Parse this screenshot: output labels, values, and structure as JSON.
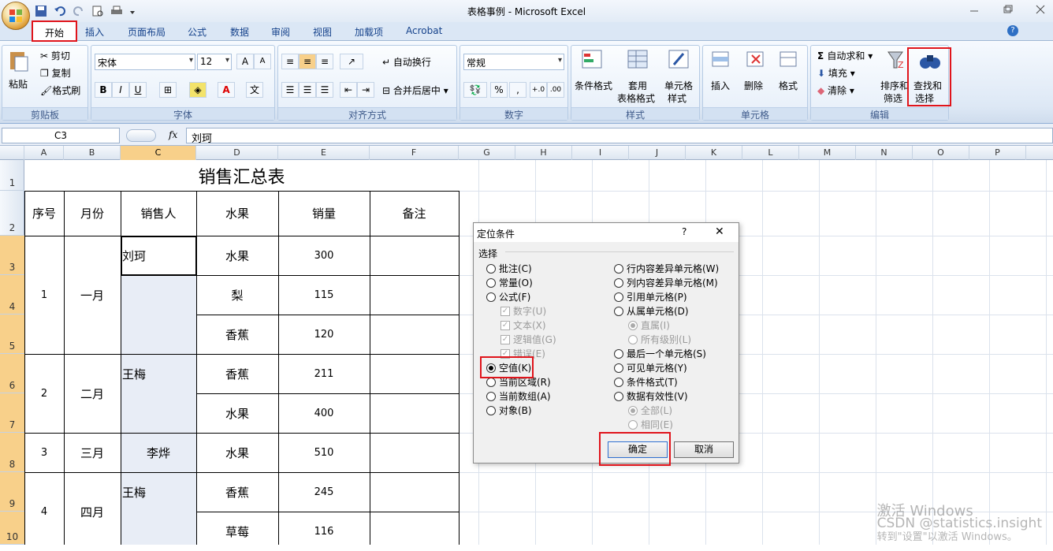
{
  "window": {
    "title": "表格事例 - Microsoft Excel"
  },
  "tabs": [
    "开始",
    "插入",
    "页面布局",
    "公式",
    "数据",
    "审阅",
    "视图",
    "加载项",
    "Acrobat"
  ],
  "ribbon": {
    "clipboard": {
      "paste": "粘贴",
      "cut": "剪切",
      "copy": "复制",
      "format_painter": "格式刷",
      "label": "剪贴板"
    },
    "font": {
      "name": "宋体",
      "size": "12",
      "label": "字体",
      "bold": "B",
      "italic": "I",
      "underline": "U",
      "grow": "A",
      "shrink": "A",
      "phonetic": "文"
    },
    "alignment": {
      "wrap": "自动换行",
      "merge": "合并后居中",
      "label": "对齐方式"
    },
    "number": {
      "format": "常规",
      "percent": "%",
      "comma": ",",
      "inc": "+.0",
      "dec": ".00",
      "label": "数字"
    },
    "styles": {
      "cond1": "条件格式",
      "cond2": "",
      "table1": "套用",
      "table2": "表格格式",
      "cell1": "单元格",
      "cell2": "样式",
      "label": "样式"
    },
    "cells": {
      "insert": "插入",
      "delete": "删除",
      "format": "格式",
      "label": "单元格"
    },
    "editing": {
      "autosum": "自动求和",
      "fill": "填充",
      "clear": "清除",
      "sort1": "排序和",
      "sort2": "筛选",
      "find1": "查找和",
      "find2": "选择",
      "label": "编辑"
    }
  },
  "formula_bar": {
    "name_box": "C3",
    "fx": "fx",
    "value": "刘珂"
  },
  "columns": [
    "A",
    "B",
    "C",
    "D",
    "E",
    "F",
    "G",
    "H",
    "I",
    "J",
    "K",
    "L",
    "M",
    "N",
    "O",
    "P"
  ],
  "rows": [
    "1",
    "2",
    "3",
    "4",
    "5",
    "6",
    "7",
    "8",
    "9",
    "10"
  ],
  "sheet": {
    "title": "销售汇总表",
    "headers": [
      "序号",
      "月份",
      "销售人",
      "水果",
      "销量",
      "备注"
    ],
    "groups": [
      {
        "seq": "1",
        "month": "一月",
        "seller": "刘珂"
      },
      {
        "seq": "2",
        "month": "二月",
        "seller": "王梅"
      },
      {
        "seq": "3",
        "month": "三月",
        "seller": "李烨"
      },
      {
        "seq": "4",
        "month": "四月",
        "seller": "王梅"
      }
    ],
    "fruit_rows": [
      {
        "fruit": "水果",
        "qty": "300"
      },
      {
        "fruit": "梨",
        "qty": "115"
      },
      {
        "fruit": "香蕉",
        "qty": "120"
      },
      {
        "fruit": "香蕉",
        "qty": "211"
      },
      {
        "fruit": "水果",
        "qty": "400"
      },
      {
        "fruit": "水果",
        "qty": "510"
      },
      {
        "fruit": "香蕉",
        "qty": "245"
      },
      {
        "fruit": "草莓",
        "qty": "116"
      }
    ]
  },
  "dialog": {
    "title": "定位条件",
    "help": "?",
    "close": "✕",
    "section": "选择",
    "left": [
      "批注(C)",
      "常量(O)",
      "公式(F)",
      "数字(U)",
      "文本(X)",
      "逻辑值(G)",
      "错误(E)",
      "空值(K)",
      "当前区域(R)",
      "当前数组(A)",
      "对象(B)"
    ],
    "right": [
      "行内容差异单元格(W)",
      "列内容差异单元格(M)",
      "引用单元格(P)",
      "从属单元格(D)",
      "直属(I)",
      "所有级别(L)",
      "最后一个单元格(S)",
      "可见单元格(Y)",
      "条件格式(T)",
      "数据有效性(V)",
      "全部(L)",
      "相同(E)"
    ],
    "ok": "确定",
    "cancel": "取消"
  },
  "watermark": {
    "line1": "激活 Windows",
    "line2": "CSDN @statistics.insight",
    "line3": "转到\"设置\"以激活 Windows。"
  }
}
